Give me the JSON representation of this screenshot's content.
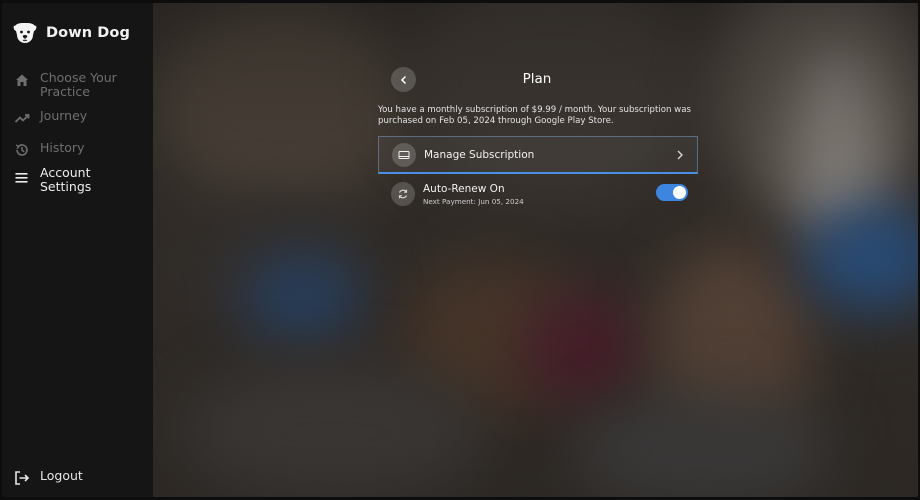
{
  "app": {
    "name": "Down Dog"
  },
  "sidebar": {
    "items": [
      {
        "label": "Choose Your Practice",
        "icon": "home-icon"
      },
      {
        "label": "Journey",
        "icon": "trending-up-icon"
      },
      {
        "label": "History",
        "icon": "history-icon"
      },
      {
        "label": "Account Settings",
        "icon": "menu-icon"
      }
    ],
    "logout": {
      "label": "Logout",
      "icon": "logout-icon"
    }
  },
  "plan": {
    "title": "Plan",
    "description": "You have a monthly subscription of $9.99 / month. Your subscription was purchased on Feb 05, 2024 through Google Play Store.",
    "manage": {
      "label": "Manage Subscription",
      "icon": "card-icon"
    },
    "auto_renew": {
      "label": "Auto-Renew On",
      "sub": "Next Payment: Jun 05, 2024",
      "icon": "refresh-icon",
      "enabled": true
    }
  },
  "colors": {
    "accent": "#3d86e0",
    "sidebar_bg": "#151515",
    "active_text": "#ededed",
    "inactive_text": "#6f6f6f"
  }
}
